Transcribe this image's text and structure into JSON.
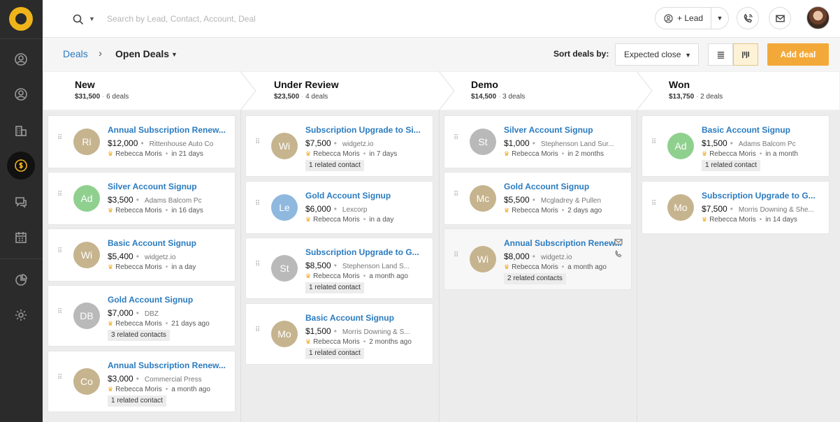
{
  "search": {
    "placeholder": "Search by Lead, Contact, Account, Deal"
  },
  "topbar": {
    "lead_label": "+ Lead"
  },
  "breadcrumb": {
    "root": "Deals",
    "current": "Open Deals"
  },
  "sort": {
    "label": "Sort deals by:",
    "value": "Expected close"
  },
  "actions": {
    "add_deal": "Add deal"
  },
  "colors": {
    "accent": "#f3a93a",
    "link": "#2a7bbf"
  },
  "sidebar": {
    "icons": [
      "logo-icon",
      "leads-icon",
      "contacts-icon",
      "accounts-icon",
      "deals-icon",
      "chat-icon",
      "calendar-icon",
      "reports-icon",
      "settings-icon"
    ]
  },
  "stages": [
    {
      "title": "New",
      "amount": "$31,500",
      "count": "6 deals"
    },
    {
      "title": "Under Review",
      "amount": "$23,500",
      "count": "4 deals"
    },
    {
      "title": "Demo",
      "amount": "$14,500",
      "count": "3 deals"
    },
    {
      "title": "Won",
      "amount": "$13,750",
      "count": "2 deals"
    }
  ],
  "cards": {
    "new": [
      {
        "initials": "Ri",
        "title": "Annual Subscription Renew...",
        "amount": "$12,000",
        "org": "Rittenhouse Auto Co",
        "owner": "Rebecca Moris",
        "time": "in 21 days",
        "tag": ""
      },
      {
        "initials": "Ad",
        "title": "Silver Account Signup",
        "amount": "$3,500",
        "org": "Adams Balcom Pc",
        "owner": "Rebecca Moris",
        "time": "in 16 days",
        "tag": ""
      },
      {
        "initials": "Wi",
        "title": "Basic Account Signup",
        "amount": "$5,400",
        "org": "widgetz.io",
        "owner": "Rebecca Moris",
        "time": "in a day",
        "tag": ""
      },
      {
        "initials": "DB",
        "title": "Gold Account Signup",
        "amount": "$7,000",
        "org": "DBZ",
        "owner": "Rebecca Moris",
        "time": "21 days ago",
        "tag": "3 related contacts"
      },
      {
        "initials": "Co",
        "title": "Annual Subscription Renew...",
        "amount": "$3,000",
        "org": "Commercial Press",
        "owner": "Rebecca Moris",
        "time": "a month ago",
        "tag": "1 related contact"
      }
    ],
    "review": [
      {
        "initials": "Wi",
        "title": "Subscription Upgrade to Si...",
        "amount": "$7,500",
        "org": "widgetz.io",
        "owner": "Rebecca Moris",
        "time": "in 7 days",
        "tag": "1 related contact"
      },
      {
        "initials": "Le",
        "title": "Gold Account Signup",
        "amount": "$6,000",
        "org": "Lexcorp",
        "owner": "Rebecca Moris",
        "time": "in a day",
        "tag": ""
      },
      {
        "initials": "St",
        "title": "Subscription Upgrade to G...",
        "amount": "$8,500",
        "org": "Stephenson Land S...",
        "owner": "Rebecca Moris",
        "time": "a month ago",
        "tag": "1 related contact"
      },
      {
        "initials": "Mo",
        "title": "Basic Account Signup",
        "amount": "$1,500",
        "org": "Morris Downing & S...",
        "owner": "Rebecca Moris",
        "time": "2 months ago",
        "tag": "1 related contact"
      }
    ],
    "demo": [
      {
        "initials": "St",
        "title": "Silver Account Signup",
        "amount": "$1,000",
        "org": "Stephenson Land Sur...",
        "owner": "Rebecca Moris",
        "time": "in 2 months",
        "tag": ""
      },
      {
        "initials": "Mc",
        "title": "Gold Account Signup",
        "amount": "$5,500",
        "org": "Mcgladrey & Pullen",
        "owner": "Rebecca Moris",
        "time": "2 days ago",
        "tag": ""
      },
      {
        "initials": "Wi",
        "title": "Annual Subscription Renew...",
        "amount": "$8,000",
        "org": "widgetz.io",
        "owner": "Rebecca Moris",
        "time": "a month ago",
        "tag": "2 related contacts"
      }
    ],
    "won": [
      {
        "initials": "Ad",
        "title": "Basic Account Signup",
        "amount": "$1,500",
        "org": "Adams Balcom Pc",
        "owner": "Rebecca Moris",
        "time": "in a month",
        "tag": "1 related contact"
      },
      {
        "initials": "Mo",
        "title": "Subscription Upgrade to G...",
        "amount": "$7,500",
        "org": "Morris Downing & She...",
        "owner": "Rebecca Moris",
        "time": "in 14 days",
        "tag": ""
      }
    ]
  }
}
